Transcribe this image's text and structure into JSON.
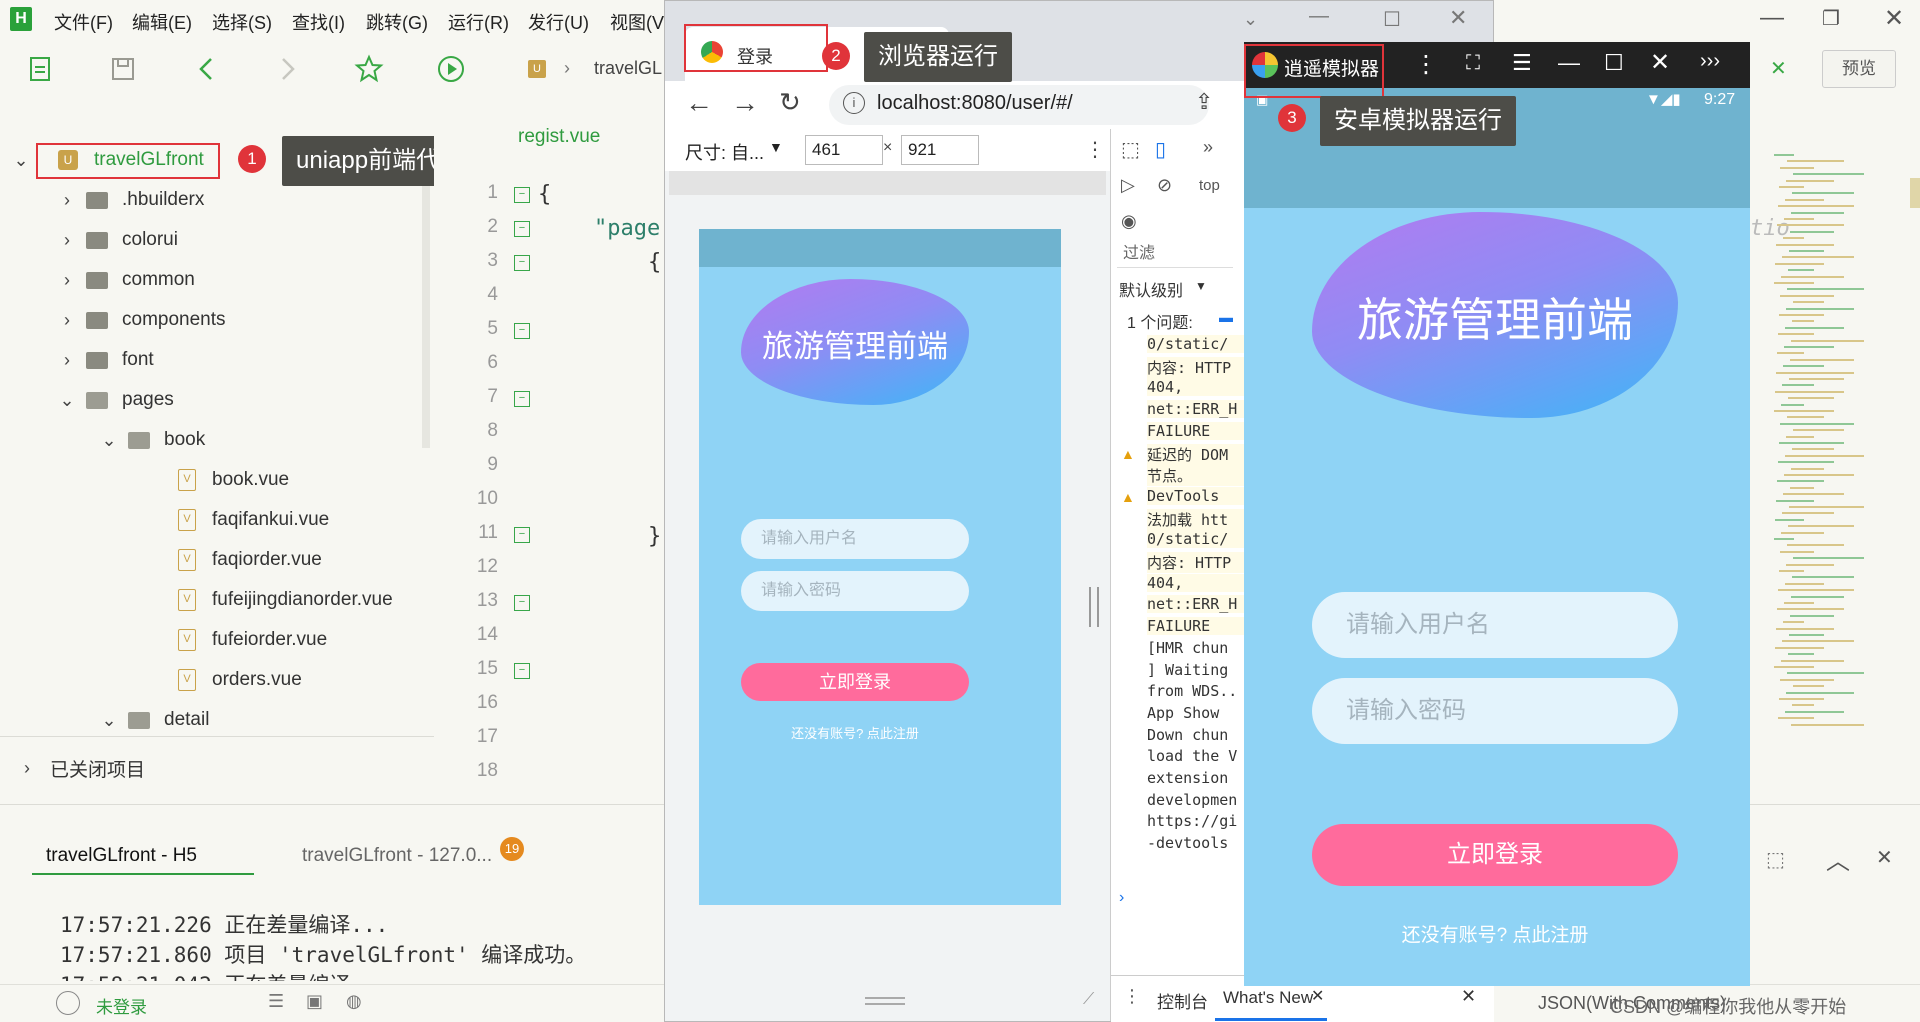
{
  "hbuilder": {
    "logo": "H",
    "menu": [
      "文件(F)",
      "编辑(E)",
      "选择(S)",
      "查找(I)",
      "跳转(G)",
      "运行(R)",
      "发行(U)",
      "视图(V"
    ],
    "breadcrumb": "travelGL",
    "preview_label": "预览",
    "sidebar": {
      "project": "travelGLfront",
      "items": [
        ".hbuilderx",
        "colorui",
        "common",
        "components",
        "font",
        "pages",
        "book",
        "book.vue",
        "faqifankui.vue",
        "faqiorder.vue",
        "fufeijingdianorder.vue",
        "fufeiorder.vue",
        "orders.vue",
        "detail"
      ],
      "closed_projects": "已关闭项目"
    },
    "editor": {
      "tab": "regist.vue",
      "line_numbers": [
        "1",
        "2",
        "3",
        "4",
        "5",
        "6",
        "7",
        "8",
        "9",
        "10",
        "11",
        "12",
        "13",
        "14",
        "15",
        "16",
        "17",
        "18"
      ],
      "code_line1": "{",
      "code_line2": "\"page",
      "code_line3": "{",
      "code_line11": "}",
      "minimap_text": "tio"
    },
    "console": {
      "tabs": [
        "travelGLfront - H5",
        "travelGLfront - 127.0..."
      ],
      "badge": "19",
      "lines": [
        "17:57:21.226 正在差量编译...",
        "17:57:21.860 项目 'travelGLfront' 编译成功。",
        "17:58:21.042 正在差量编译"
      ]
    },
    "status": {
      "login": "未登录",
      "right": "JSON(With Comments)",
      "watermark": "CSDN @编程你我他从零开始"
    }
  },
  "callouts": [
    {
      "num": "1",
      "text": "uniapp前端代码"
    },
    {
      "num": "2",
      "text": "浏览器运行"
    },
    {
      "num": "3",
      "text": "安卓模拟器运行"
    }
  ],
  "chrome": {
    "tab_title": "登录",
    "url": "localhost:8080/user/#/",
    "device_label": "尺寸: 自...",
    "width": "461",
    "height": "921",
    "devtools": {
      "filter": "过滤",
      "level": "默认级别",
      "issues": "1 个问题:",
      "top_label": "top",
      "bottom_tabs": [
        "控制台",
        "What's New"
      ],
      "log_lines": [
        "0/static/",
        "内容: HTTP",
        "404,",
        "net::ERR_H",
        "FAILURE",
        "延迟的 DOM",
        "节点。",
        "DevTools ",
        "法加载 htt",
        "0/static/",
        "内容: HTTP",
        "404,",
        "net::ERR_H",
        "FAILURE",
        "[HMR chun",
        "] Waiting",
        "from WDS..",
        "App Show",
        "Down chun",
        "load the V",
        "extension",
        "developmen",
        "https://gi",
        "-devtools"
      ]
    }
  },
  "app": {
    "title": "旅游管理前端",
    "username_placeholder": "请输入用户名",
    "password_placeholder": "请输入密码",
    "login_button": "立即登录",
    "register_link": "还没有账号? 点此注册"
  },
  "emulator": {
    "name": "逍遥模拟器",
    "time": "9:27"
  },
  "colors": {
    "app_bg": "#8fd3f5",
    "header_bar": "#6fb3cf",
    "button": "#ff6b9c",
    "input": "#e3f3fc",
    "accent_green": "#39a845",
    "callout_red": "#e0343a"
  }
}
